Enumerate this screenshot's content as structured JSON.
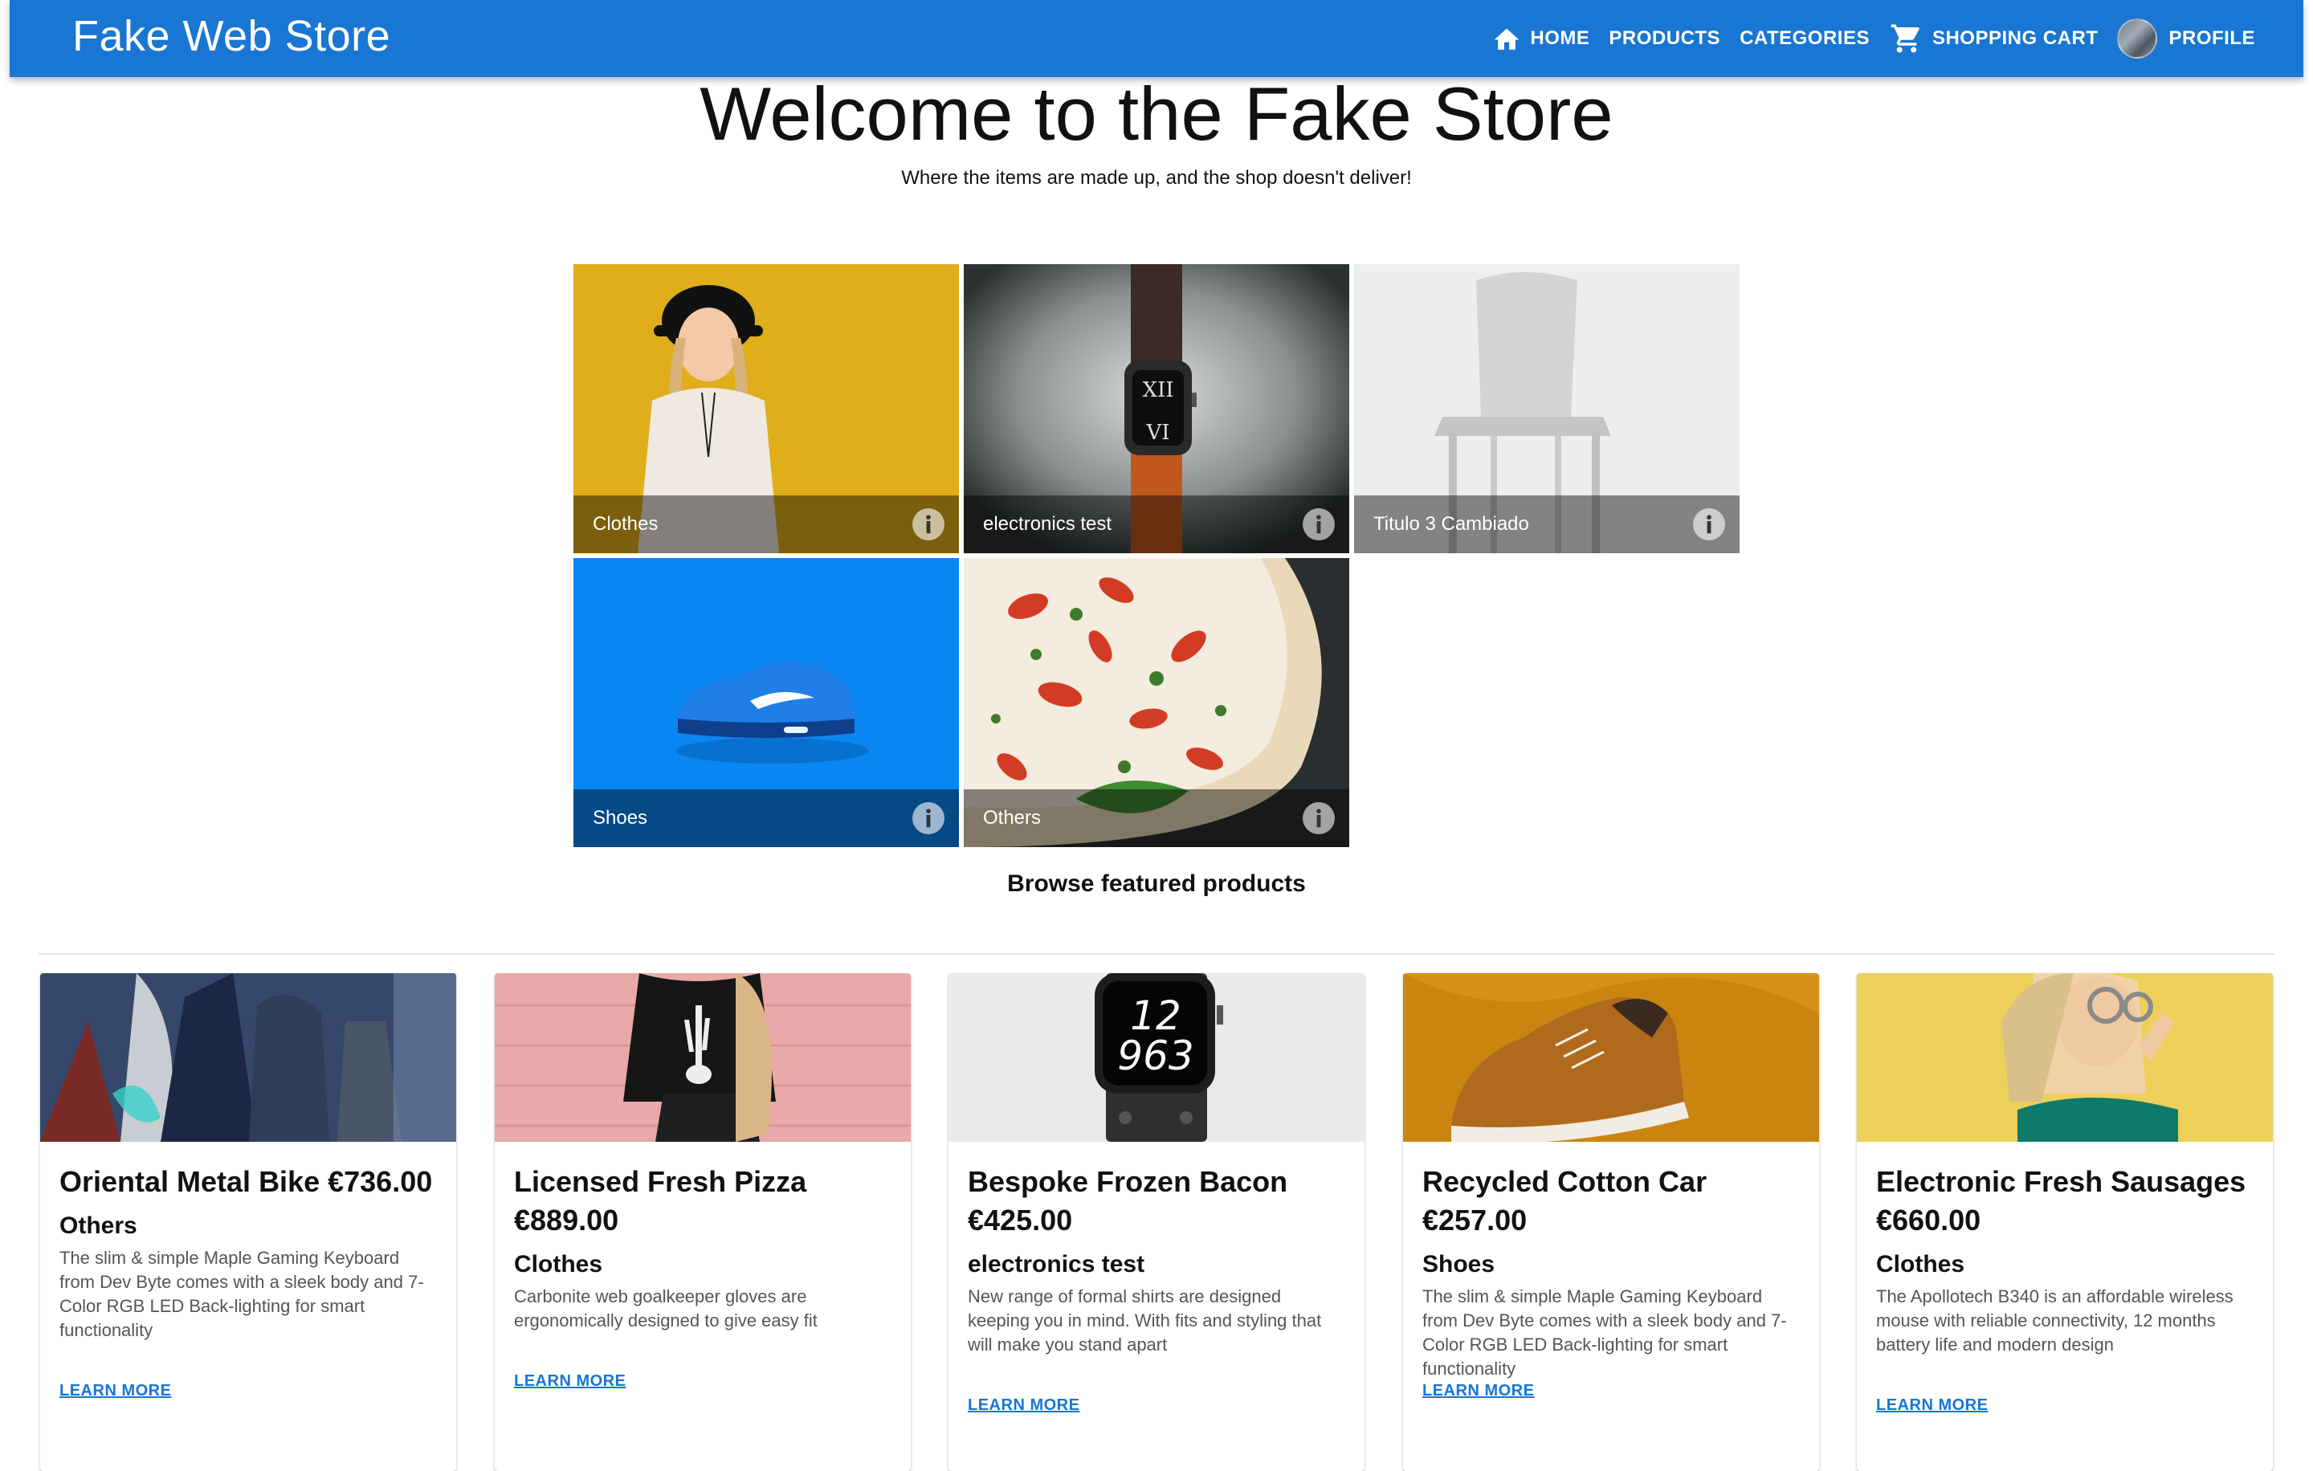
{
  "header": {
    "brand": "Fake Web Store",
    "nav": {
      "home": "HOME",
      "products": "PRODUCTS",
      "categories": "CATEGORIES",
      "cart": "SHOPPING CART",
      "profile": "PROFILE"
    }
  },
  "hero": {
    "title": "Welcome to the Fake Store",
    "subtitle": "Where the items are made up, and the shop doesn't deliver!"
  },
  "categories": [
    {
      "label": "Clothes",
      "icon": "info-icon"
    },
    {
      "label": "electronics test",
      "icon": "info-icon"
    },
    {
      "label": "Titulo 3 Cambiado",
      "icon": "info-icon"
    },
    {
      "label": "Shoes",
      "icon": "info-icon"
    },
    {
      "label": "Others",
      "icon": "info-icon"
    }
  ],
  "browse_label": "Browse featured products",
  "products": [
    {
      "title": "Oriental Metal Bike €736.00",
      "category": "Others",
      "description": "The slim & simple Maple Gaming Keyboard from Dev Byte comes with a sleek body and 7-Color RGB LED Back-lighting for smart functionality",
      "action": "LEARN MORE"
    },
    {
      "title": "Licensed Fresh Pizza €889.00",
      "category": "Clothes",
      "description": "Carbonite web goalkeeper gloves are ergonomically designed to give easy fit",
      "action": "LEARN MORE"
    },
    {
      "title": "Bespoke Frozen Bacon €425.00",
      "category": "electronics test",
      "description": "New range of formal shirts are designed keeping you in mind. With fits and styling that will make you stand apart",
      "action": "LEARN MORE"
    },
    {
      "title": "Recycled Cotton Car €257.00",
      "category": "Shoes",
      "description": "The slim & simple Maple Gaming Keyboard from Dev Byte comes with a sleek body and 7-Color RGB LED Back-lighting for smart functionality",
      "action": "LEARN MORE"
    },
    {
      "title": "Electronic Fresh Sausages €660.00",
      "category": "Clothes",
      "description": "The Apollotech B340 is an affordable wireless mouse with reliable connectivity, 12 months battery life and modern design",
      "action": "LEARN MORE"
    }
  ],
  "colors": {
    "primary": "#1976d2",
    "link": "#1976d2"
  }
}
